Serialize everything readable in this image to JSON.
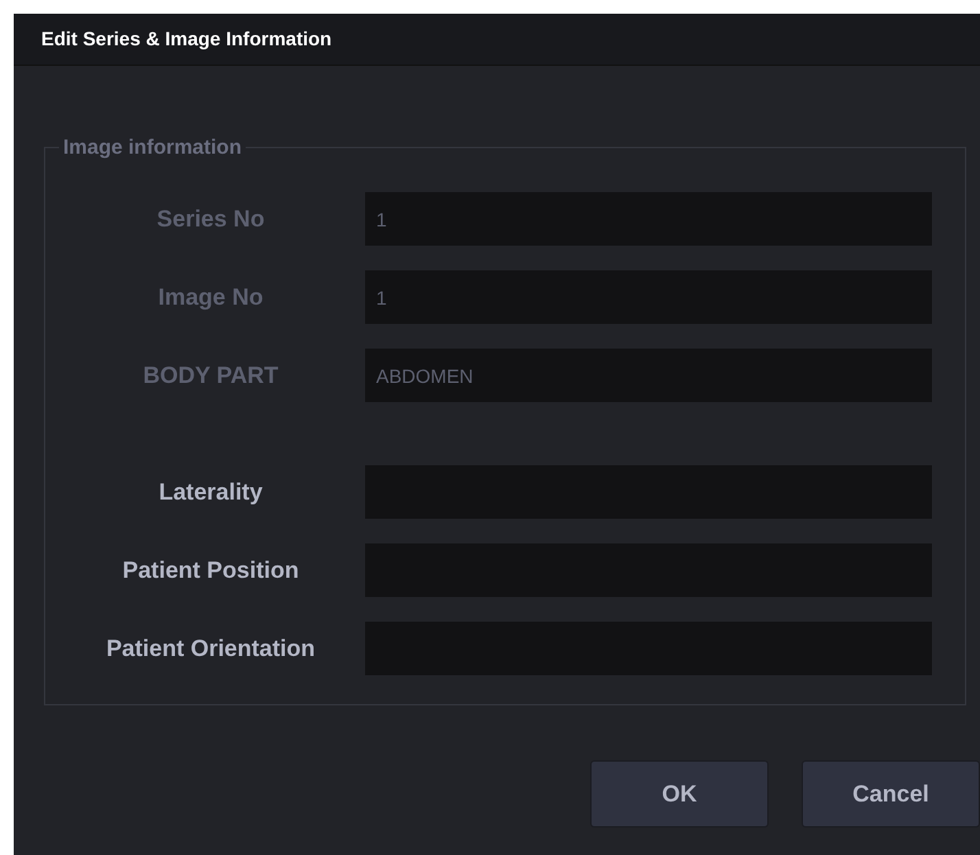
{
  "window": {
    "title": "Edit Series & Image Information"
  },
  "group": {
    "title": "Image information",
    "fields": [
      {
        "label": "Series No",
        "value": "1",
        "disabled": true
      },
      {
        "label": "Image No",
        "value": "1",
        "disabled": true
      },
      {
        "label": "BODY PART",
        "value": "ABDOMEN",
        "disabled": true
      },
      {
        "label": "Laterality",
        "disabled": false
      },
      {
        "label": "Patient Position",
        "disabled": false
      },
      {
        "label": "Patient Orientation",
        "disabled": false
      }
    ]
  },
  "buttons": [
    "OK",
    "Cancel"
  ]
}
